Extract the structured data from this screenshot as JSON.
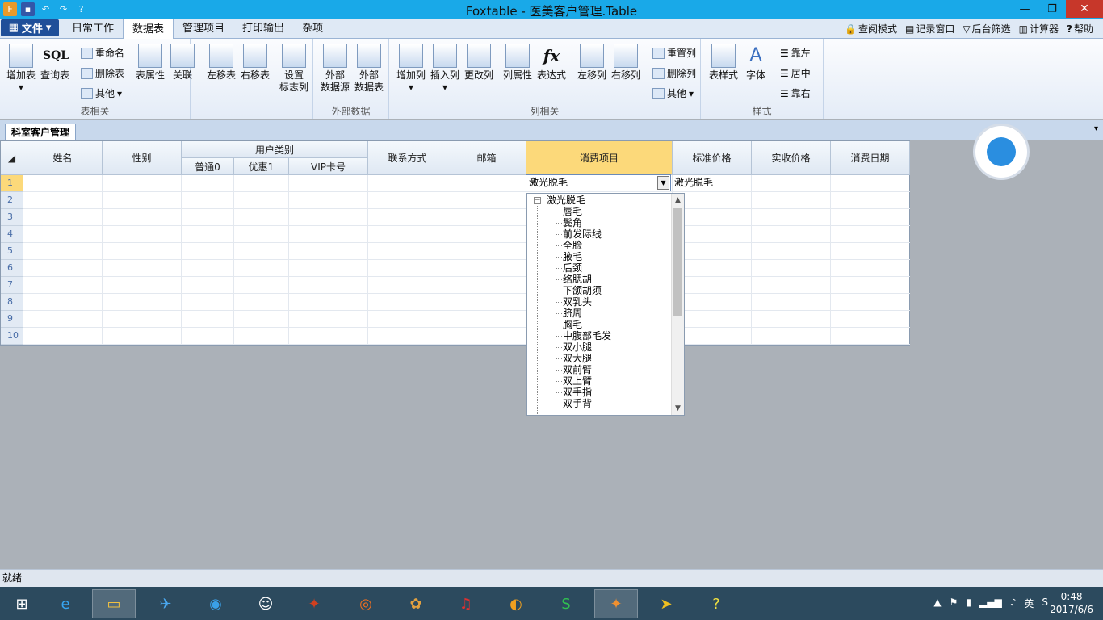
{
  "window": {
    "title": "Foxtable - 医美客户管理.Table"
  },
  "menu": {
    "file": "文件",
    "tabs": [
      "日常工作",
      "数据表",
      "管理项目",
      "打印输出",
      "杂项"
    ],
    "active_tab": 1
  },
  "top_right": {
    "query_mode": "查阅模式",
    "record_window": "记录窗口",
    "background_filter": "后台筛选",
    "calculator": "计算器",
    "help": "帮助"
  },
  "ribbon": {
    "table_group": {
      "label": "表相关",
      "add_table": "增加表",
      "query_table": "查询表",
      "sql": "SQL",
      "rename": "重命名",
      "delete_table": "删除表",
      "other": "其他",
      "table_props": "表属性",
      "relation": "关联",
      "move_left": "左移表",
      "move_right": "右移表",
      "set_flag_l1": "设置",
      "set_flag_l2": "标志列"
    },
    "external_group": {
      "label": "外部数据",
      "ext_source_l1": "外部",
      "ext_source_l2": "数据源",
      "ext_table_l1": "外部",
      "ext_table_l2": "数据表"
    },
    "column_group": {
      "label": "列相关",
      "add_col": "增加列",
      "insert_col": "插入列",
      "change_col": "更改列",
      "col_props": "列属性",
      "expression": "表达式",
      "fx": "fx",
      "move_col_left": "左移列",
      "move_col_right": "右移列",
      "reset_col": "重置列",
      "delete_col": "删除列",
      "other": "其他"
    },
    "style_group": {
      "label": "样式",
      "table_style": "表样式",
      "font": "字体",
      "align_left": "靠左",
      "align_center": "居中",
      "align_right": "靠右"
    }
  },
  "doc_tab": {
    "title": "科室客户管理"
  },
  "grid": {
    "columns": [
      "姓名",
      "性别",
      "用户类别",
      "联系方式",
      "邮箱",
      "消费项目",
      "标准价格",
      "实收价格",
      "消费日期"
    ],
    "sub_columns": [
      "普通0",
      "优惠1",
      "VIP卡号"
    ],
    "row_numbers": [
      "1",
      "2",
      "3",
      "4",
      "5",
      "6",
      "7",
      "8",
      "9",
      "10"
    ],
    "row1_consumption": "激光脱毛",
    "row1_price": "激光脱毛"
  },
  "dropdown": {
    "root": "激光脱毛",
    "items": [
      "唇毛",
      "鬓角",
      "前发际线",
      "全脸",
      "腋毛",
      "后颈",
      "络腮胡",
      "下颌胡须",
      "双乳头",
      "脐周",
      "胸毛",
      "中腹部毛发",
      "双小腿",
      "双大腿",
      "双前臂",
      "双上臂",
      "双手指",
      "双手背"
    ]
  },
  "status": {
    "text": "就绪"
  },
  "taskbar": {
    "time": "0:48",
    "date": "2017/6/6",
    "ime": "英"
  }
}
